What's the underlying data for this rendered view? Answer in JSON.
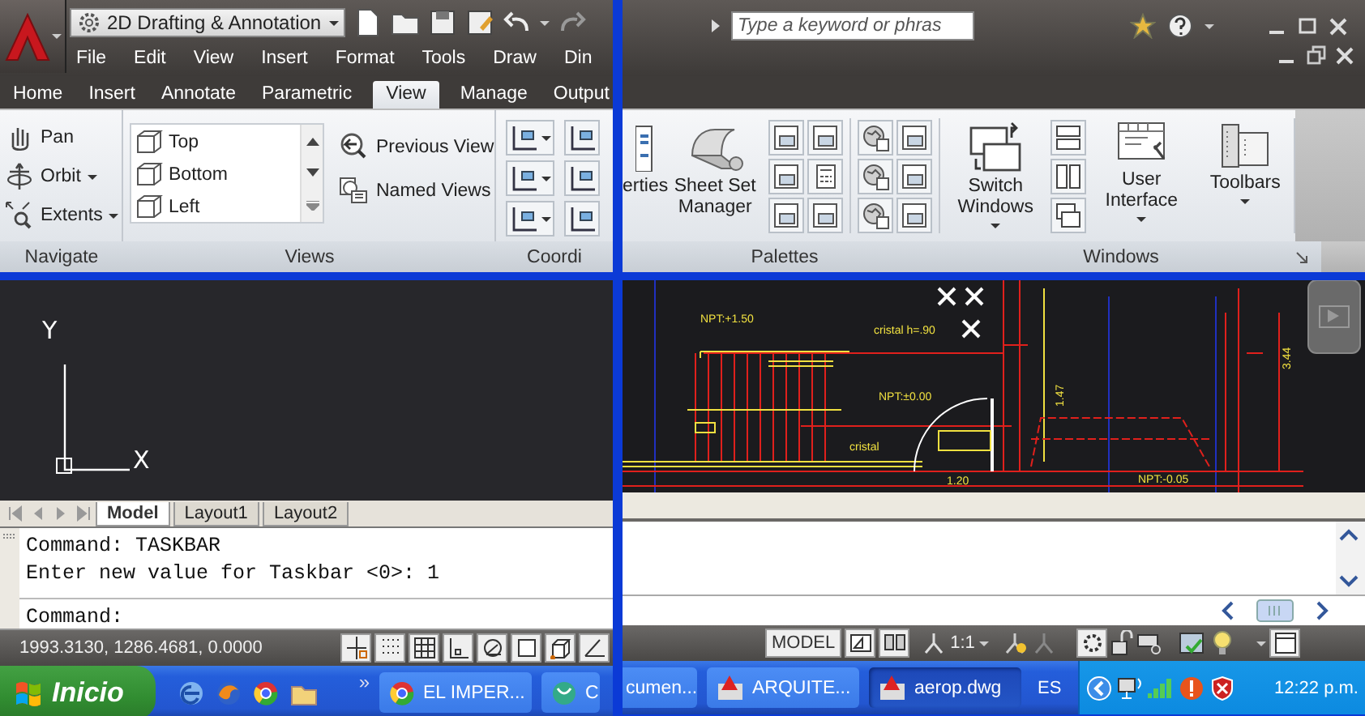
{
  "top_left": {
    "workspace": "2D Drafting & Annotation",
    "menu": [
      "File",
      "Edit",
      "View",
      "Insert",
      "Format",
      "Tools",
      "Draw",
      "Din"
    ],
    "tabs": [
      {
        "label": "Home",
        "selected": false
      },
      {
        "label": "Insert",
        "selected": false
      },
      {
        "label": "Annotate",
        "selected": false
      },
      {
        "label": "Parametric",
        "selected": false
      },
      {
        "label": "View",
        "selected": true
      },
      {
        "label": "Manage",
        "selected": false
      },
      {
        "label": "Output",
        "selected": false
      }
    ],
    "navigate": [
      {
        "label": "Pan",
        "dropdown": false
      },
      {
        "label": "Orbit",
        "dropdown": true
      },
      {
        "label": "Extents",
        "dropdown": true
      }
    ],
    "views": [
      "Top",
      "Bottom",
      "Left"
    ],
    "view_buttons": [
      "Previous View",
      "Named Views"
    ],
    "panel_labels": [
      "Navigate",
      "Views",
      "Coordi"
    ]
  },
  "top_right": {
    "search": {
      "placeholder": "Type a keyword or phras"
    },
    "palette_buttons": [
      {
        "label": "erties"
      },
      {
        "label": "Sheet Set Manager"
      }
    ],
    "window_buttons": [
      {
        "label": "Switch Windows",
        "dropdown": true
      },
      {
        "label": "User Interface",
        "dropdown": true
      },
      {
        "label": "Toolbars",
        "dropdown": true
      }
    ],
    "panel_labels": [
      "Palettes",
      "Windows"
    ]
  },
  "bottom_left": {
    "axis_labels": [
      "Y",
      "X"
    ],
    "layout_tabs": [
      {
        "label": "Model",
        "selected": true
      },
      {
        "label": "Layout1",
        "selected": false
      },
      {
        "label": "Layout2",
        "selected": false
      }
    ],
    "command_history": [
      "Command: TASKBAR",
      "Enter new value for Taskbar <0>: 1"
    ],
    "command_prompt": "Command:",
    "coordinates": "1993.3130, 1286.4681, 0.0000",
    "taskbar": {
      "start": "Inicio",
      "overflow": "»",
      "buttons": [
        {
          "label": "EL IMPER...",
          "selected": false
        },
        {
          "label": "C",
          "selected": false
        }
      ]
    }
  },
  "bottom_right": {
    "drawing_labels": [
      "NPT:+1.50",
      "cristal h=.90",
      "NPT:±0.00",
      "cristal",
      "1.20",
      "NPT:-0.05",
      "1.47",
      "3.44"
    ],
    "status": {
      "model": "MODEL",
      "scale": "1:1"
    },
    "taskbar": {
      "buttons": [
        {
          "label": "cumen...",
          "selected": false
        },
        {
          "label": "ARQUITE...",
          "selected": false
        },
        {
          "label": "aerop.dwg",
          "selected": true
        }
      ],
      "language": "ES",
      "clock": "12:22 p.m."
    }
  }
}
